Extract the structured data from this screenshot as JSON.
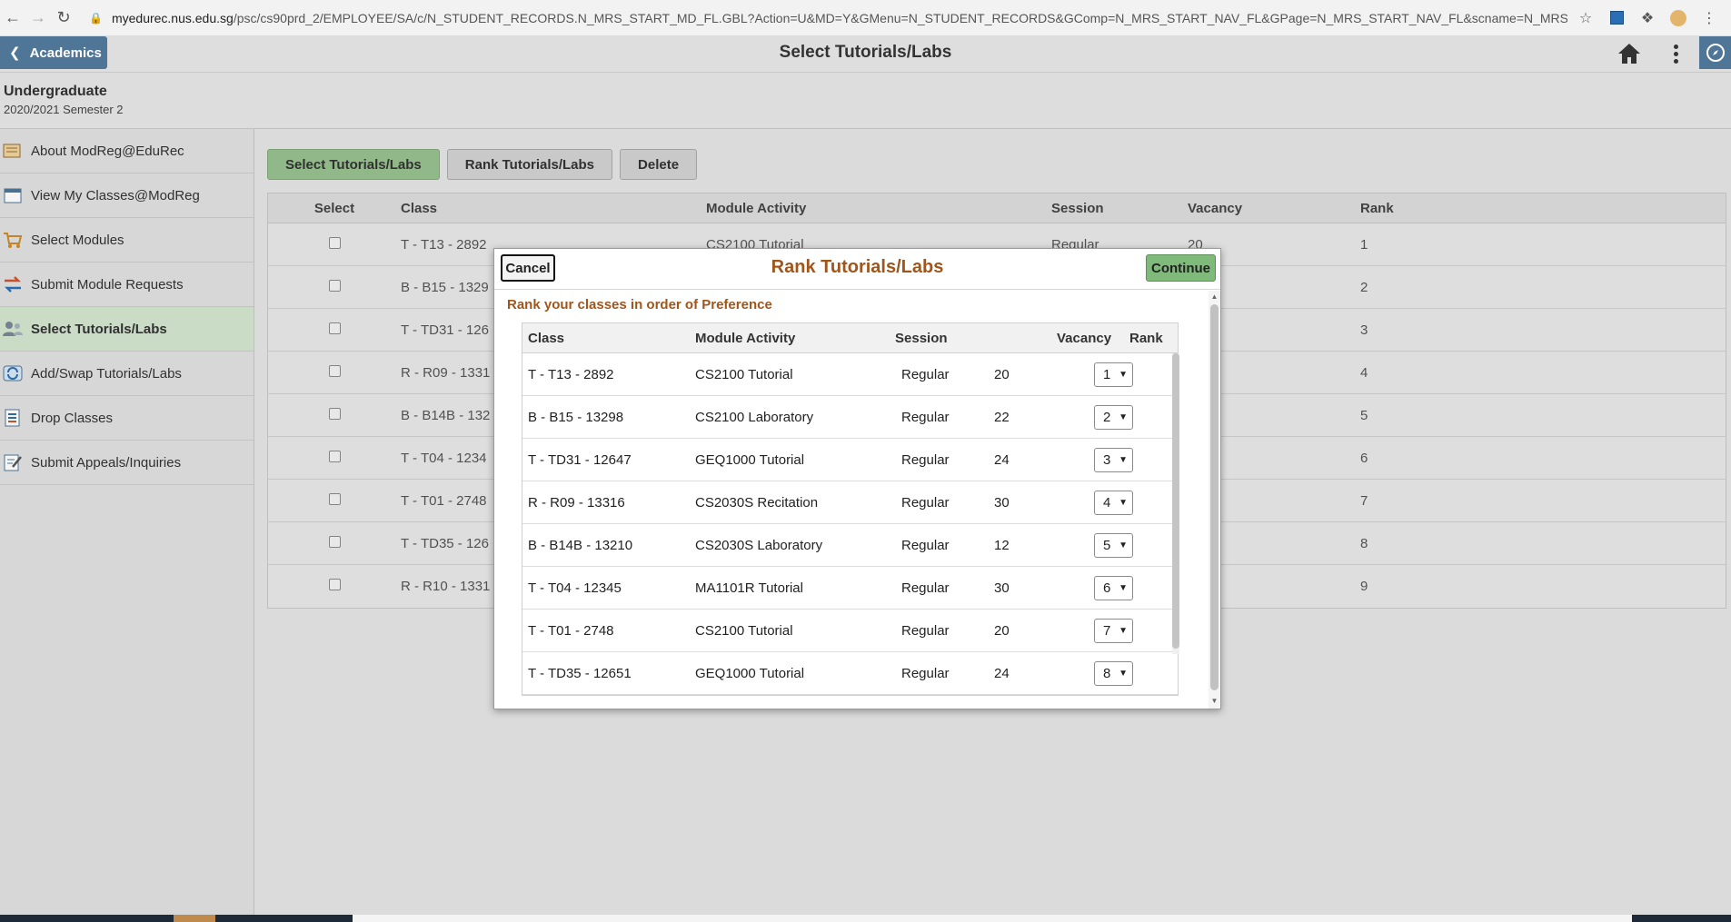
{
  "browser": {
    "url_domain": "myedurec.nus.edu.sg",
    "url_path": "/psc/cs90prd_2/EMPLOYEE/SA/c/N_STUDENT_RECORDS.N_MRS_START_MD_FL.GBL?Action=U&MD=Y&GMenu=N_STUDENT_RECORDS&GComp=N_MRS_START_NAV_FL&GPage=N_MRS_START_NAV_FL&scname=N_MRS_MODULE_REG_..."
  },
  "header": {
    "back_label": "Academics",
    "title": "Select Tutorials/Labs"
  },
  "context": {
    "career": "Undergraduate",
    "term": "2020/2021 Semester 2"
  },
  "sidebar": {
    "items": [
      {
        "label": "About ModReg@EduRec",
        "icon": "book-icon"
      },
      {
        "label": "View My Classes@ModReg",
        "icon": "calendar-icon"
      },
      {
        "label": "Select Modules",
        "icon": "cart-icon"
      },
      {
        "label": "Submit Module Requests",
        "icon": "swap-arrows-icon"
      },
      {
        "label": "Select Tutorials/Labs",
        "icon": "people-icon"
      },
      {
        "label": "Add/Swap Tutorials/Labs",
        "icon": "refresh-icon"
      },
      {
        "label": "Drop Classes",
        "icon": "list-remove-icon"
      },
      {
        "label": "Submit Appeals/Inquiries",
        "icon": "form-edit-icon"
      }
    ],
    "active_index": 4
  },
  "toolbar": {
    "select_label": "Select Tutorials/Labs",
    "rank_label": "Rank Tutorials/Labs",
    "delete_label": "Delete"
  },
  "bg_table": {
    "headers": {
      "select": "Select",
      "class": "Class",
      "activity": "Module Activity",
      "session": "Session",
      "vacancy": "Vacancy",
      "rank": "Rank"
    },
    "rows": [
      {
        "class": "T - T13 - 2892",
        "activity": "CS2100 Tutorial",
        "session": "Regular",
        "vacancy": "20",
        "rank": "1"
      },
      {
        "class": "B - B15 - 1329",
        "activity": "",
        "session": "",
        "vacancy": "22",
        "rank": "2"
      },
      {
        "class": "T - TD31 - 126",
        "activity": "",
        "session": "",
        "vacancy": "24",
        "rank": "3"
      },
      {
        "class": "R - R09 - 1331",
        "activity": "",
        "session": "",
        "vacancy": "30",
        "rank": "4"
      },
      {
        "class": "B - B14B - 132",
        "activity": "",
        "session": "",
        "vacancy": "12",
        "rank": "5"
      },
      {
        "class": "T - T04 - 1234",
        "activity": "",
        "session": "",
        "vacancy": "30",
        "rank": "6"
      },
      {
        "class": "T - T01 - 2748",
        "activity": "",
        "session": "",
        "vacancy": "20",
        "rank": "7"
      },
      {
        "class": "T - TD35 - 126",
        "activity": "",
        "session": "",
        "vacancy": "24",
        "rank": "8"
      },
      {
        "class": "R - R10 - 1331",
        "activity": "",
        "session": "",
        "vacancy": "30",
        "rank": "9"
      }
    ]
  },
  "modal": {
    "title": "Rank Tutorials/Labs",
    "cancel_label": "Cancel",
    "continue_label": "Continue",
    "instruction": "Rank your classes in order of Preference",
    "headers": {
      "class": "Class",
      "activity": "Module Activity",
      "session": "Session",
      "vacancy": "Vacancy",
      "rank": "Rank"
    },
    "rows": [
      {
        "class": "T - T13 - 2892",
        "activity": "CS2100 Tutorial",
        "session": "Regular",
        "vacancy": "20",
        "rank": "1"
      },
      {
        "class": "B - B15 - 13298",
        "activity": "CS2100 Laboratory",
        "session": "Regular",
        "vacancy": "22",
        "rank": "2"
      },
      {
        "class": "T - TD31 - 12647",
        "activity": "GEQ1000 Tutorial",
        "session": "Regular",
        "vacancy": "24",
        "rank": "3"
      },
      {
        "class": "R - R09 - 13316",
        "activity": "CS2030S Recitation",
        "session": "Regular",
        "vacancy": "30",
        "rank": "4"
      },
      {
        "class": "B - B14B - 13210",
        "activity": "CS2030S Laboratory",
        "session": "Regular",
        "vacancy": "12",
        "rank": "5"
      },
      {
        "class": "T - T04 - 12345",
        "activity": "MA1101R Tutorial",
        "session": "Regular",
        "vacancy": "30",
        "rank": "6"
      },
      {
        "class": "T - T01 - 2748",
        "activity": "CS2100 Tutorial",
        "session": "Regular",
        "vacancy": "20",
        "rank": "7"
      },
      {
        "class": "T - TD35 - 12651",
        "activity": "GEQ1000 Tutorial",
        "session": "Regular",
        "vacancy": "24",
        "rank": "8"
      }
    ]
  },
  "colors": {
    "accent_orange": "#a0561a",
    "header_blue": "#4f7696",
    "button_green": "#97c08f",
    "active_nav_bg": "#d3e4cf"
  }
}
